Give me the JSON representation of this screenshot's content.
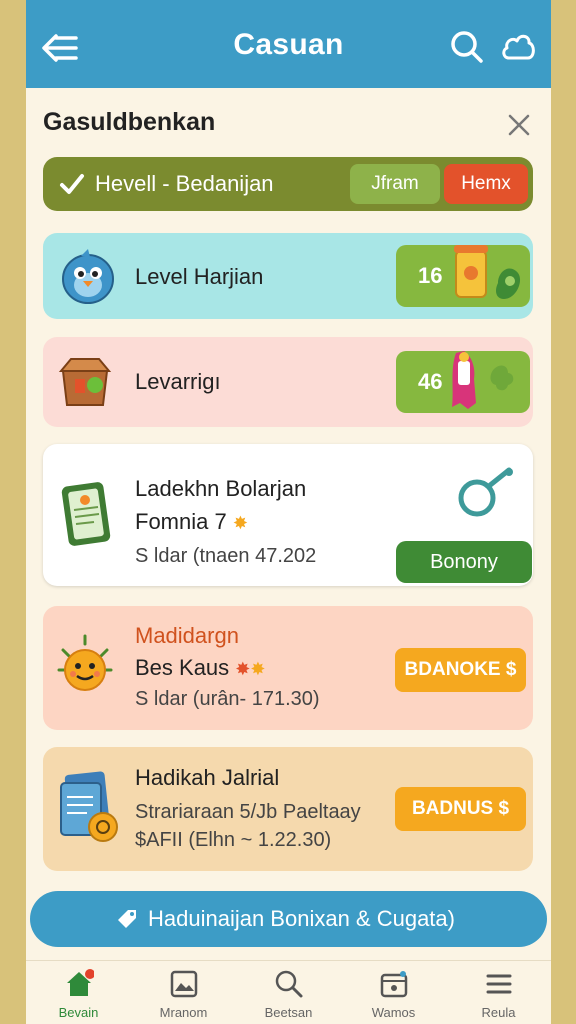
{
  "header": {
    "title": "Casuan"
  },
  "section": {
    "title": "Gasuldbenkan"
  },
  "filter": {
    "label": "Hevell - Bedanijan",
    "option1": "Jfram",
    "option2": "Hemx"
  },
  "cards": [
    {
      "title": "Level Harjian",
      "badge": "16"
    },
    {
      "title": "Levarrigı",
      "badge": "46"
    },
    {
      "title": "Ladekhn Bolarjan",
      "title2": "Fomnia 7",
      "subtitle": "S ldar (tnaen 47.202",
      "button": "Bonony"
    },
    {
      "title": "Madidargn",
      "title2": "Bes Kaus",
      "subtitle": "S ldar (urân- 171.30)",
      "button": "BDANOKE $"
    },
    {
      "title": "Hadikah Jalrial",
      "subtitle": "Strariaraan 5/Jb Paeltaay",
      "subtitle2": "$AFII (Elhn ~ 1.22.30)",
      "button": "BADNUS $"
    }
  ],
  "cta": {
    "label": "Haduinaijan Bonixan & Cugata)"
  },
  "nav": [
    {
      "label": "Bevain",
      "icon": "home-icon",
      "active": true
    },
    {
      "label": "Mranom",
      "icon": "image-icon"
    },
    {
      "label": "Beetsan",
      "icon": "search-icon"
    },
    {
      "label": "Wamos",
      "icon": "calendar-icon"
    },
    {
      "label": "Reula",
      "icon": "menu-icon"
    }
  ],
  "colors": {
    "header": "#3d9cc6",
    "filter": "#7b8b2f",
    "green": "#86b83f",
    "orange": "#f5a81f"
  }
}
